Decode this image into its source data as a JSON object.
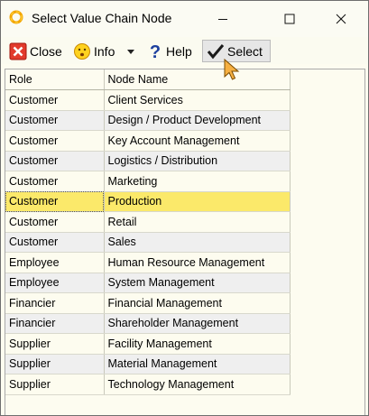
{
  "window": {
    "title": "Select Value Chain Node"
  },
  "toolbar": {
    "close_label": "Close",
    "info_label": "Info",
    "help_label": "Help",
    "select_label": "Select"
  },
  "table": {
    "columns": [
      "Role",
      "Node Name"
    ],
    "selected_index": 5,
    "rows": [
      {
        "role": "Customer",
        "node": "Client Services"
      },
      {
        "role": "Customer",
        "node": "Design / Product Development"
      },
      {
        "role": "Customer",
        "node": "Key Account Management"
      },
      {
        "role": "Customer",
        "node": "Logistics / Distribution"
      },
      {
        "role": "Customer",
        "node": "Marketing"
      },
      {
        "role": "Customer",
        "node": "Production"
      },
      {
        "role": "Customer",
        "node": "Retail"
      },
      {
        "role": "Customer",
        "node": "Sales"
      },
      {
        "role": "Employee",
        "node": "Human Resource Management"
      },
      {
        "role": "Employee",
        "node": "System Management"
      },
      {
        "role": "Financier",
        "node": "Financial Management"
      },
      {
        "role": "Financier",
        "node": "Shareholder Management"
      },
      {
        "role": "Supplier",
        "node": "Facility Management"
      },
      {
        "role": "Supplier",
        "node": "Material Management"
      },
      {
        "role": "Supplier",
        "node": "Technology Management"
      }
    ]
  },
  "colors": {
    "selected_row": "#fbe96a",
    "window_bg": "#fdfcf0"
  },
  "icons": {
    "app": "app-ring-icon",
    "close": "close-x-icon",
    "info": "info-smiley-icon",
    "help": "help-question-icon",
    "select": "checkmark-icon"
  }
}
